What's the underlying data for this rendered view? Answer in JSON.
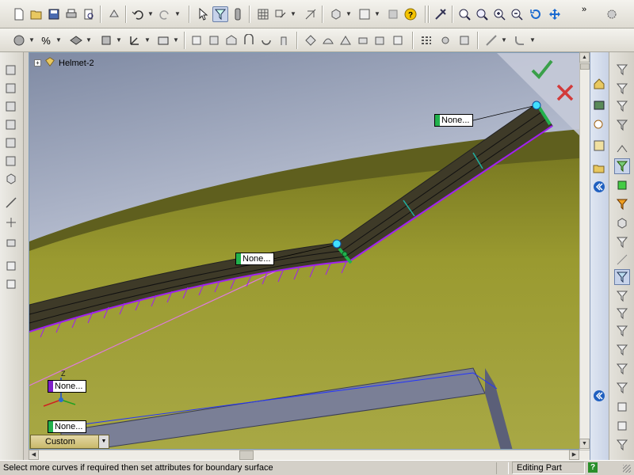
{
  "feature_tree": {
    "part_name": "Helmet-2"
  },
  "callouts": [
    {
      "id": "top",
      "label": "None...",
      "color": "#22b14c"
    },
    {
      "id": "mid",
      "label": "None...",
      "color": "#22b14c"
    },
    {
      "id": "dir2",
      "label": "None...",
      "color": "#7f20c8"
    },
    {
      "id": "dir1",
      "label": "None...",
      "color": "#22b14c"
    }
  ],
  "triad_label": "Z",
  "view_orientation": {
    "value": "Custom"
  },
  "status_bar": {
    "message": "Select more curves if required then set attributes for boundary surface",
    "mode": "Editing Part",
    "help": "?"
  },
  "colors": {
    "surface": "#9a9a30",
    "confirm": "#3aa04a",
    "cancel": "#d23a3a",
    "selection_purple": "#a020f0"
  }
}
